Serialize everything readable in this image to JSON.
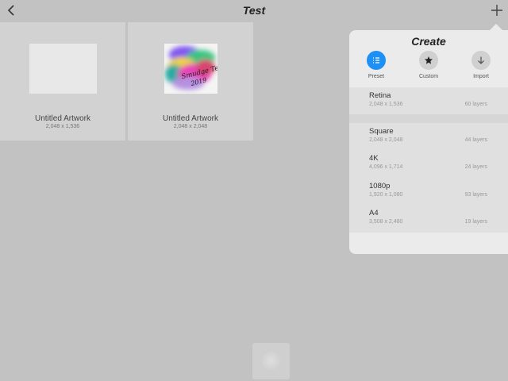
{
  "header": {
    "title": "Test"
  },
  "gallery": {
    "items": [
      {
        "name": "Untitled Artwork",
        "size": "2,048 x 1,536"
      },
      {
        "name": "Untitled Artwork",
        "size": "2,048 x 2,048",
        "thumbnail_text": "Smudge Test 2019"
      }
    ]
  },
  "create_popover": {
    "title": "Create",
    "tabs": [
      {
        "label": "Preset",
        "icon": "list-icon",
        "active": true
      },
      {
        "label": "Custom",
        "icon": "star-icon",
        "active": false
      },
      {
        "label": "Import",
        "icon": "download-arrow-icon",
        "active": false
      }
    ],
    "recent": [
      {
        "name": "Retina",
        "dims": "2,048 x 1,536",
        "layers": "60 layers"
      }
    ],
    "presets": [
      {
        "name": "Square",
        "dims": "2,048 x 2,048",
        "layers": "44 layers"
      },
      {
        "name": "4K",
        "dims": "4,096 x 1,714",
        "layers": "24 layers"
      },
      {
        "name": "1080p",
        "dims": "1,920 x 1,080",
        "layers": "93 layers"
      },
      {
        "name": "A4",
        "dims": "3,508 x 2,480",
        "layers": "19 layers"
      }
    ]
  },
  "colors": {
    "accent": "#1e8ff5",
    "background": "#c2c2c2",
    "popover": "#ebebeb"
  }
}
